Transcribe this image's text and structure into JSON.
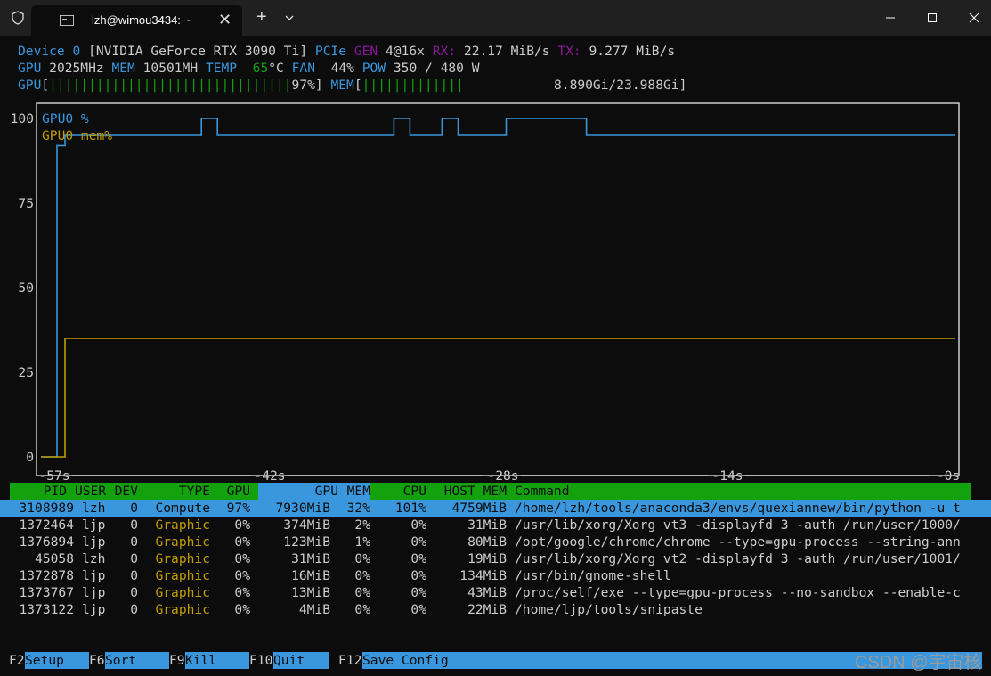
{
  "titlebar": {
    "tab_title": "lzh@wimou3434: ~",
    "tab_close": "✕",
    "new_tab": "+"
  },
  "status": {
    "device_label": "Device 0",
    "device_name": "[NVIDIA GeForce RTX 3090 Ti]",
    "pcie_label": "PCIe",
    "gen_label": "GEN",
    "gen_value": "4@16x",
    "rx_label": "RX:",
    "rx_value": "22.17 MiB/s",
    "tx_label": "TX:",
    "tx_value": "9.277 MiB/s",
    "gpu_label": "GPU",
    "gpu_clock": "2025MHz",
    "mem_label": "MEM",
    "mem_clock": "10501MH",
    "temp_label": "TEMP",
    "temp_value": "65",
    "temp_unit": "°C",
    "fan_label": "FAN",
    "fan_value": "44%",
    "pow_label": "POW",
    "pow_value": "350 / 480 W",
    "gpu_bar_label": "GPU",
    "gpu_bar_fill": "|||||||||||||||||||||||||||||||",
    "gpu_bar_pct": "97%",
    "mem_bar_label": "MEM",
    "mem_bar_fill": "|||||||||||||",
    "mem_bar_value": "8.890Gi/23.988Gi"
  },
  "chart_data": {
    "type": "line",
    "yticks": [
      "100",
      "75",
      "50",
      "25",
      "0"
    ],
    "xticks": [
      "-57s",
      "-42s",
      "-28s",
      "-14s",
      "-0s"
    ],
    "ylim": [
      0,
      100
    ],
    "xlim": [
      -57,
      0
    ],
    "legend": [
      "GPU0 %",
      "GPU0 mem%"
    ],
    "series": [
      {
        "name": "GPU0 %",
        "color": "#3a96dd",
        "points": [
          [
            -57,
            0
          ],
          [
            -56,
            0
          ],
          [
            -56,
            92
          ],
          [
            -55.5,
            92
          ],
          [
            -55.5,
            95
          ],
          [
            -47,
            95
          ],
          [
            -47,
            100
          ],
          [
            -46,
            100
          ],
          [
            -46,
            95
          ],
          [
            -35,
            95
          ],
          [
            -35,
            100
          ],
          [
            -34,
            100
          ],
          [
            -34,
            95
          ],
          [
            -32,
            95
          ],
          [
            -32,
            100
          ],
          [
            -31,
            100
          ],
          [
            -31,
            95
          ],
          [
            -28,
            95
          ],
          [
            -28,
            100
          ],
          [
            -23,
            100
          ],
          [
            -23,
            95
          ],
          [
            0,
            95
          ]
        ]
      },
      {
        "name": "GPU0 mem%",
        "color": "#c19c00",
        "points": [
          [
            -57,
            0
          ],
          [
            -55.5,
            0
          ],
          [
            -55.5,
            35
          ],
          [
            0,
            35
          ]
        ]
      }
    ]
  },
  "table": {
    "headers": [
      "PID",
      "USER",
      "DEV",
      "TYPE",
      "GPU",
      "GPU MEM",
      "CPU",
      "HOST MEM",
      "Command"
    ],
    "rows": [
      [
        "3108989",
        "lzh",
        "0",
        "Compute",
        "97%",
        "7930MiB",
        "32%",
        "101%",
        "4759MiB",
        "/home/lzh/tools/anaconda3/envs/quexiannew/bin/python -u t"
      ],
      [
        "1372464",
        "ljp",
        "0",
        "Graphic",
        "0%",
        "374MiB",
        "2%",
        "0%",
        "31MiB",
        "/usr/lib/xorg/Xorg vt3 -displayfd 3 -auth /run/user/1000/"
      ],
      [
        "1376894",
        "ljp",
        "0",
        "Graphic",
        "0%",
        "123MiB",
        "1%",
        "0%",
        "80MiB",
        "/opt/google/chrome/chrome --type=gpu-process --string-ann"
      ],
      [
        "45058",
        "lzh",
        "0",
        "Graphic",
        "0%",
        "31MiB",
        "0%",
        "0%",
        "19MiB",
        "/usr/lib/xorg/Xorg vt2 -displayfd 3 -auth /run/user/1001/"
      ],
      [
        "1372878",
        "ljp",
        "0",
        "Graphic",
        "0%",
        "16MiB",
        "0%",
        "0%",
        "134MiB",
        "/usr/bin/gnome-shell"
      ],
      [
        "1373767",
        "ljp",
        "0",
        "Graphic",
        "0%",
        "13MiB",
        "0%",
        "0%",
        "43MiB",
        "/proc/self/exe --type=gpu-process --no-sandbox --enable-c"
      ],
      [
        "1373122",
        "ljp",
        "0",
        "Graphic",
        "0%",
        "4MiB",
        "0%",
        "0%",
        "22MiB",
        "/home/ljp/tools/snipaste"
      ]
    ]
  },
  "footer": [
    {
      "key": "F2",
      "label": "Setup"
    },
    {
      "key": "F6",
      "label": "Sort"
    },
    {
      "key": "F9",
      "label": "Kill"
    },
    {
      "key": "F10",
      "label": "Quit"
    },
    {
      "key": "F12",
      "label": "Save Config"
    }
  ],
  "watermark": "CSDN @宇宙核"
}
